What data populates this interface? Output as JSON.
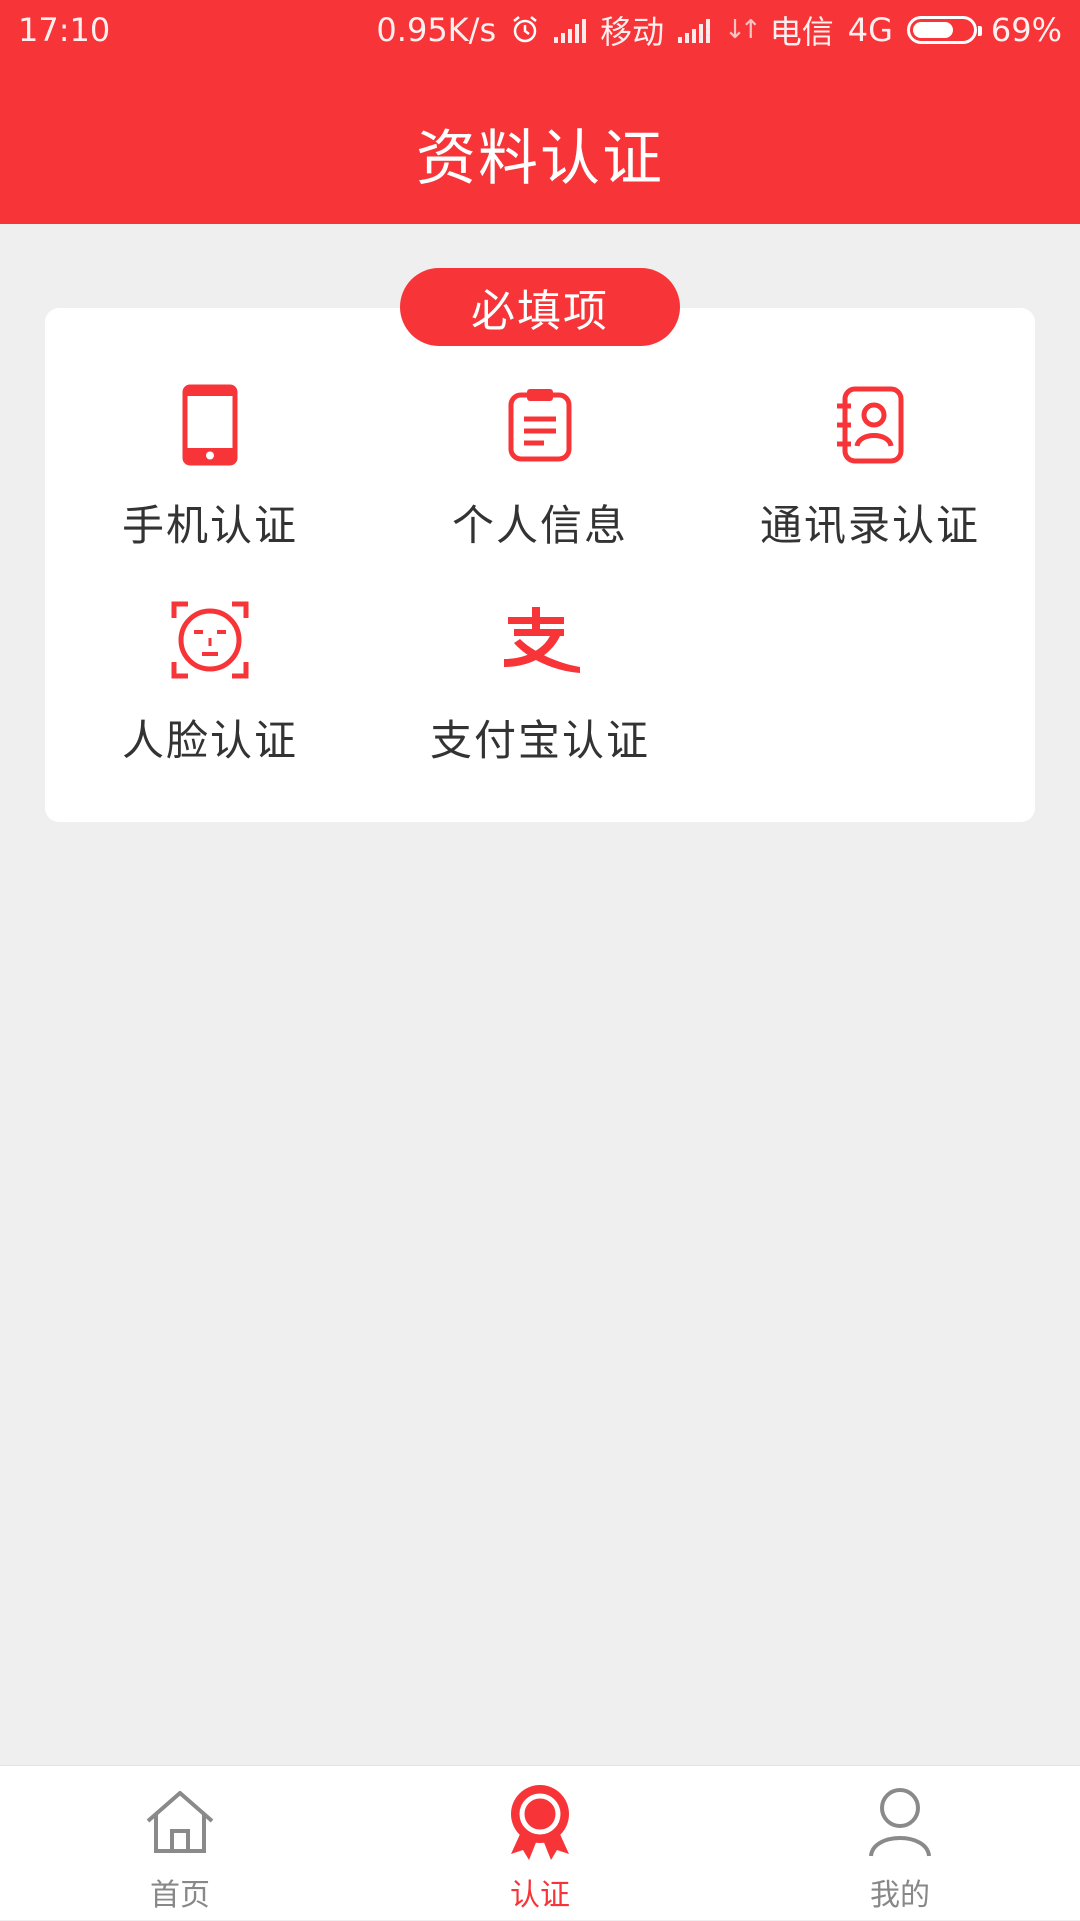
{
  "status_bar": {
    "time": "17:10",
    "speed": "0.95K/s",
    "carrier1": "移动",
    "carrier2": "电信",
    "network": "4G",
    "battery": "69%",
    "battery_level": 0.69
  },
  "header": {
    "title": "资料认证"
  },
  "section": {
    "badge": "必填项"
  },
  "items": [
    {
      "label": "手机认证",
      "icon": "phone-icon"
    },
    {
      "label": "个人信息",
      "icon": "clipboard-icon"
    },
    {
      "label": "通讯录认证",
      "icon": "contacts-icon"
    },
    {
      "label": "人脸认证",
      "icon": "face-scan-icon"
    },
    {
      "label": "支付宝认证",
      "icon": "alipay-icon"
    }
  ],
  "tabbar": {
    "tabs": [
      {
        "label": "首页",
        "icon": "home-icon"
      },
      {
        "label": "认证",
        "icon": "badge-icon",
        "active": true
      },
      {
        "label": "我的",
        "icon": "user-icon"
      }
    ]
  },
  "colors": {
    "accent": "#f73437",
    "background": "#efefef",
    "text": "#333333",
    "tab_inactive": "#888888"
  }
}
